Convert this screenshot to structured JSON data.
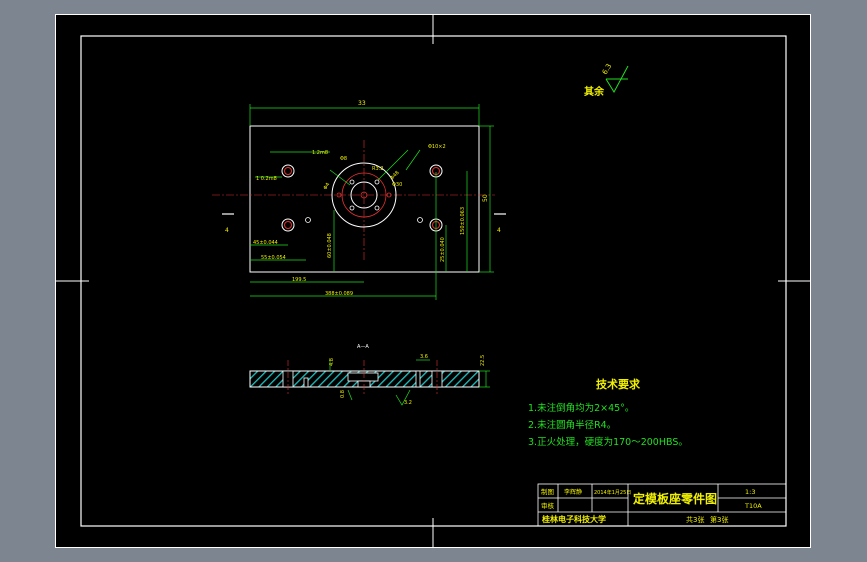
{
  "roughness": {
    "label": "其余",
    "value": "6.3"
  },
  "dimensions": {
    "overall_width": "33",
    "d1": "1.2m8",
    "d2": "1 0.2m8",
    "d3": "R3.2",
    "d4": "Φ48",
    "d5": "Φ10×2",
    "d6": "Φ30",
    "d7": "Φ4",
    "d8": "Φ8",
    "d9": "45±0.044",
    "d10": "55±0.054",
    "d11": "199.5",
    "d12": "388±0.089",
    "d13": "60±0.048",
    "d14": "150±0.063",
    "d15": "25±0.040",
    "d16": "50",
    "d17": "4",
    "d18": "4"
  },
  "section": {
    "title": "A—A",
    "dim_a": "4.8",
    "dim_b": "3.6",
    "dim_c": "22.5",
    "dim_d": "0.8",
    "rough": "3.2"
  },
  "tech": {
    "title": "技术要求",
    "items": [
      "1.未注倒角均为2×45°。",
      "2.未注圆角半径R4。",
      "3.正火处理，硬度为170～200HBS。"
    ]
  },
  "title_block": {
    "drawn_label": "制图",
    "drawn_name": "李辉静",
    "date": "2014年1月25日",
    "check_label": "审核",
    "drawing_title": "定模板座零件图",
    "scale": "1:3",
    "material": "T10A",
    "school": "桂林电子科技大学",
    "sheets": "共3张",
    "sheet_no": "第3张"
  }
}
